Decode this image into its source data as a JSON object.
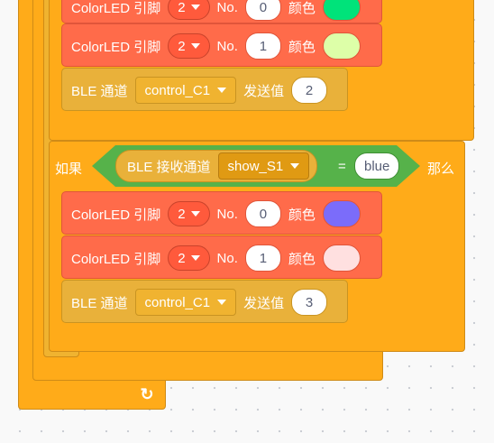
{
  "blocks": {
    "led_label": "ColorLED 引脚",
    "no_label": "No.",
    "color_label": "颜色",
    "ble_channel_label": "BLE 通道",
    "send_label": "发送值",
    "ble_receive_label": "BLE 接收通道",
    "if_label": "如果",
    "then_label": "那么",
    "equals": "="
  },
  "top_group": {
    "led0": {
      "pin": "2",
      "no": "0",
      "color": "#00e37a"
    },
    "led1": {
      "pin": "2",
      "no": "1",
      "color": "#ddffa8"
    },
    "ble_send": {
      "channel": "control_C1",
      "value": "2"
    }
  },
  "if_block": {
    "receive_channel": "show_S1",
    "compare_value": "blue",
    "led0": {
      "pin": "2",
      "no": "0",
      "color": "#7b6cfa"
    },
    "led1": {
      "pin": "2",
      "no": "1",
      "color": "#ffe0e0"
    },
    "ble_send": {
      "channel": "control_C1",
      "value": "3"
    }
  },
  "icons": {
    "loop_arrow": "↻"
  },
  "colors": {
    "control_orange": "#ffab19",
    "led_red": "#ff6b4a",
    "ble_yellow": "#e9b13a",
    "operator_green": "#56b24a"
  }
}
